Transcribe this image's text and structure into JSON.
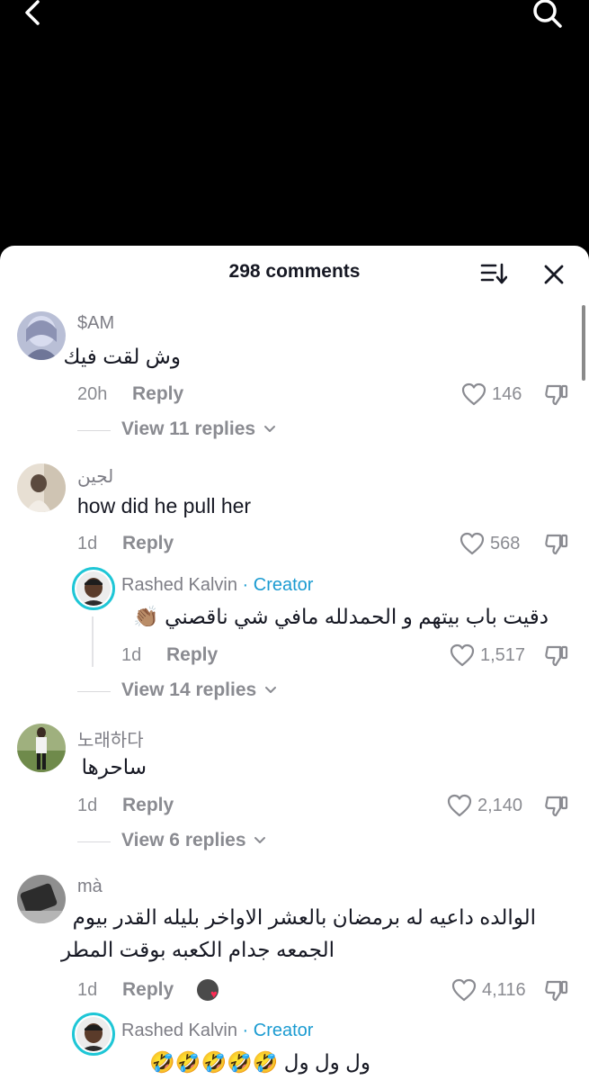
{
  "header": {
    "comment_count": "298 comments"
  },
  "icons": {
    "back": "chevron-left-icon",
    "search": "search-icon",
    "sort": "sort-icon",
    "close": "close-icon",
    "like": "heart-outline-icon",
    "dislike": "thumbs-down-icon"
  },
  "colors": {
    "creator": "#1b9bd1",
    "ring": "#1ec6d6",
    "muted": "#8a8b91",
    "heart_badge": "#fe2c55"
  },
  "comments": [
    {
      "username": "$AM",
      "text": "وش لقت فيك",
      "time": "20h",
      "reply_label": "Reply",
      "likes": "146",
      "view_replies": "View 11 replies"
    },
    {
      "username": "لجين",
      "text": "how did he pull her",
      "time": "1d",
      "reply_label": "Reply",
      "likes": "568",
      "creator_reply": {
        "username": "Rashed Kalvin",
        "creator_badge": "· Creator",
        "text": "دقيت باب بيتهم و الحمدلله مافي شي ناقصني 👏🏽",
        "time": "1d",
        "reply_label": "Reply",
        "likes": "1,517"
      },
      "view_replies": "View 14 replies"
    },
    {
      "username": "노래하다",
      "text": "ساحرها",
      "time": "1d",
      "reply_label": "Reply",
      "likes": "2,140",
      "view_replies": "View 6 replies"
    },
    {
      "username": "mà",
      "text_line1": "الوالده داعيه له برمضان بالعشر الاواخر بليله القدر بيوم",
      "text_line2": "الجمعه جدام الكعبه بوقت المطر",
      "time": "1d",
      "reply_label": "Reply",
      "likes": "4,116",
      "creator_reply": {
        "username": "Rashed Kalvin",
        "creator_badge": "· Creator",
        "text": "ول ول ول 🤣🤣🤣🤣🤣"
      }
    }
  ]
}
